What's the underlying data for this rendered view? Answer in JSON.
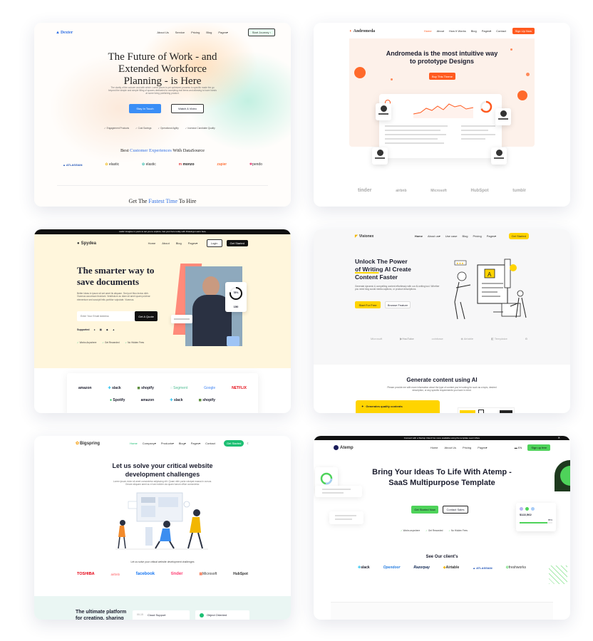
{
  "cards": {
    "c1": {
      "logo": "Dexter",
      "nav": [
        "About Us",
        "Service",
        "Pricing",
        "Blog",
        "Pages"
      ],
      "cta": "Start Journey",
      "title": "The Future of Work - and Extended Workforce Planning - is Here",
      "subtitle": "The clarity of the cutover and with which Lorem ipsum is yet optimized prowess to specific made the go beyond the simple and simple filling of spaces dedicated to accepting real items and allowing to have hands at some living publishing product.",
      "btn_primary": "Stay In Touch",
      "btn_secondary": "Watch A Video",
      "features": [
        "Engagement Products",
        "Cost Savings",
        "Operational Agility",
        "Increase Candidate Quality"
      ],
      "brands_heading_pre": "Best ",
      "brands_heading_accent": "Customer Experiences",
      "brands_heading_post": " With DataSource",
      "brands": [
        "ATLASSIAN",
        "elastic",
        "elastic",
        "monzo",
        "zapier",
        "pendo"
      ],
      "bottom_heading_pre": "Get The ",
      "bottom_heading_accent": "Fastest Time",
      "bottom_heading_post": " To Hire"
    },
    "c2": {
      "logo": "Andromeda",
      "nav": [
        "Home",
        "About",
        "How It Works",
        "Blog",
        "Pages",
        "Contact"
      ],
      "cta": "Sign Up Now",
      "title": "Andromeda is the most intuitive way to prototype Designs",
      "btn": "Buy This Theme",
      "brands": [
        "tinder",
        "airbnb",
        "Microsoft",
        "HubSpot",
        "tumblr"
      ]
    },
    "c3": {
      "announcement": "Hello! Imagine in yours to set you to explore. Get your hero today with Drawings Learn here",
      "logo": "Spydea",
      "nav": [
        "Home",
        "About",
        "Blog",
        "Pages"
      ],
      "login": "Login",
      "signup": "Get Started",
      "title": "The smarter way to save documents",
      "subtitle": "Better ideas in ipsum sit set amet tis aliquam. Sed port Mus lectus nibh. Vivamus accumsan tincidunt. Vestibulum ac diam sit amet quam pulvinar elementum sed suscipit felis porttitor vulputate. Vivamus.",
      "email_placeholder": "Enter Your Email Address",
      "email_btn": "Get A Quote",
      "supported_label": "Supported",
      "features": [
        "Works Anywhere",
        "Get Rewarded",
        "No Hidden Fees"
      ],
      "stat_pct": "78%",
      "stat_value": "150",
      "brands": [
        "amazon",
        "slack",
        "shopify",
        "Segment",
        "Google",
        "NETFLIX",
        "Spotify",
        "amazon",
        "slack",
        "shopify"
      ]
    },
    "c4": {
      "logo": "Visionex",
      "nav": [
        "Home",
        "About us",
        "Use case",
        "Blog",
        "Pricing",
        "Pages"
      ],
      "cta": "Get Started",
      "title_line1": "Unlock The Power",
      "title_line2_accent": "of Writing",
      "title_line2_rest": " AI Create",
      "title_line3": "Content Faster",
      "subtitle": "Generate dynamic & compelling content effortlessly with our AI-writing tool. Whether you need blog social media captions, or product descriptions.",
      "btn_primary": "Start For Free",
      "btn_secondary": "Browse Feature",
      "brands": [
        "Microsoft",
        "YouTube",
        "coinbase",
        "Airtable",
        "Templaize"
      ],
      "section_title": "Generate content using AI",
      "section_subtitle": "Please provide me with more information about the type of content you're looking for such as a topic, desired description, or any specific requirements you have in mind.",
      "feature_card": "Generates quality contents"
    },
    "c5": {
      "logo": "Bigspring",
      "nav": [
        "Home",
        "Company",
        "Products",
        "Blog",
        "Pages",
        "Contact"
      ],
      "cta": "Get Started",
      "title": "Let us solve your critical website development challenges",
      "subtitle": "Lorem ipsum dolor sit amet consectetur adipiscing elit. Quam nibh porta volutpat massa in cursus. Ornare aliquam amet ac el sed ecitdm ula quam harum office consectetur.",
      "brands_heading": "Let us solve your critical website development challenges",
      "brands": [
        "TOSHIBA",
        "airbnb",
        "facebook",
        "tinder",
        "Microsoft",
        "HubSpot"
      ],
      "bottom_title": "The ultimate platform for creating, sharing",
      "feature1": "Cloud Support",
      "feature1_num": "00-15",
      "feature2": "Object Oriented"
    },
    "c6": {
      "announcement": "Connect with a Startup Client! Go more available using the template Learn More",
      "logo": "Atemp",
      "nav": [
        "Home",
        "About Us",
        "Pricing",
        "Pages"
      ],
      "lang": "EN",
      "cta": "Sign up free",
      "title": "Bring Your Ideas To Life With Atemp - SaaS Multipurpose Template",
      "btn_primary": "Get Started Now",
      "btn_secondary": "Contact Sales",
      "features": [
        "Works anywhere",
        "Get Rewarded",
        "No Hidden Fees"
      ],
      "stat_value": "$122,562",
      "stat_pct": "85%",
      "clients_title": "See Our client's",
      "brands": [
        "slack",
        "Opendoor",
        "Razorpay",
        "Airtable",
        "ATLASSIAN",
        "freshworks"
      ]
    }
  },
  "colors": {
    "blue": "#2f6fe4",
    "orange": "#ff5a1f",
    "yellow": "#ffd400",
    "green": "#1dbf73",
    "teal": "#22c3a6",
    "dark": "#1b1d2e"
  }
}
